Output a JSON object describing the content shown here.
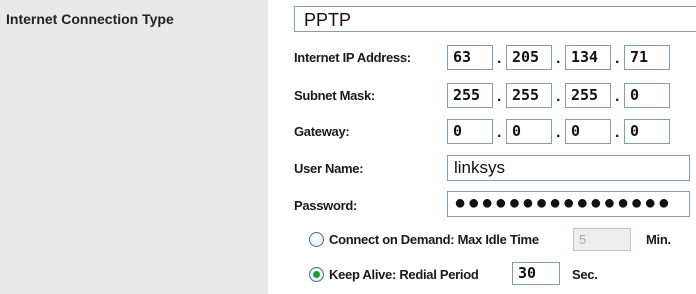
{
  "sidebar": {
    "title": "Internet Connection Type"
  },
  "connection_type": {
    "selected": "PPTP"
  },
  "fields": {
    "ip_label": "Internet IP Address:",
    "ip": [
      "63",
      "205",
      "134",
      "71"
    ],
    "mask_label": "Subnet Mask:",
    "mask": [
      "255",
      "255",
      "255",
      "0"
    ],
    "gateway_label": "Gateway:",
    "gateway": [
      "0",
      "0",
      "0",
      "0"
    ],
    "username_label": "User Name:",
    "username": "linksys",
    "password_label": "Password:",
    "password": "●●●●●●●●●●●●●●●●",
    "dot": "."
  },
  "options": {
    "connect_on_demand_label": "Connect on Demand: Max Idle Time",
    "max_idle_value": "5",
    "max_idle_unit": "Min.",
    "keep_alive_label": "Keep Alive: Redial Period",
    "redial_value": "30",
    "redial_unit": "Sec.",
    "selected": "keep_alive"
  }
}
